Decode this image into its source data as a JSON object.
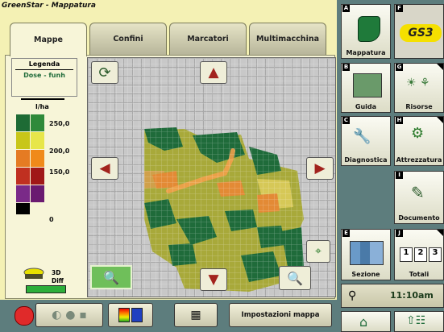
{
  "app": {
    "title": "GreenStar - Mappatura"
  },
  "tabs": [
    {
      "label": "Mappe",
      "active": true
    },
    {
      "label": "Confini",
      "active": false
    },
    {
      "label": "Marcatori",
      "active": false
    },
    {
      "label": "Multimacchina",
      "active": false
    }
  ],
  "legend": {
    "title": "Legenda",
    "subtitle": "Dose - funh",
    "unit": "l/ha",
    "values": [
      "250,0",
      "200,0",
      "150,0",
      "0"
    ],
    "colors": [
      "#1e6b35",
      "#2f8a3a",
      "#c8c619",
      "#e7e64a",
      "#e57b23",
      "#f08a1a",
      "#c03020",
      "#a01818",
      "#7a2a88",
      "#6a1a70",
      "#000000"
    ],
    "mode_label_1": "3D",
    "mode_label_2": "Diff"
  },
  "map": {
    "colors": {
      "green_dark": "#1f6b3a",
      "olive": "#a8a93a",
      "orange": "#e38a35",
      "light_orange": "#f1b35a",
      "grid": "#c8c8c8"
    }
  },
  "side_tiles": [
    {
      "letter": "A",
      "label": "Mappatura",
      "icon": "field-map-icon"
    },
    {
      "letter": "F",
      "label": "",
      "icon": "gs3-logo",
      "logo_text": "GS3"
    },
    {
      "letter": "B",
      "label": "Guida",
      "icon": "guidance-icon"
    },
    {
      "letter": "G",
      "label": "Risorse",
      "icon": "resources-icon"
    },
    {
      "letter": "C",
      "label": "Diagnostica",
      "icon": "wrench-book-icon"
    },
    {
      "letter": "H",
      "label": "Attrezzatura",
      "icon": "implement-icon"
    },
    {
      "letter": "I",
      "label": "Documento",
      "icon": "document-pencil-icon"
    },
    {
      "letter": "E",
      "label": "Sezione",
      "icon": "section-chart-icon"
    },
    {
      "letter": "J",
      "label": "Totali",
      "icon": "counter-icon",
      "counter": [
        "1",
        "2",
        "3"
      ]
    }
  ],
  "status": {
    "time": "11:10am"
  },
  "bottom_bar": {
    "settings_label": "Impostazioni mappa"
  }
}
